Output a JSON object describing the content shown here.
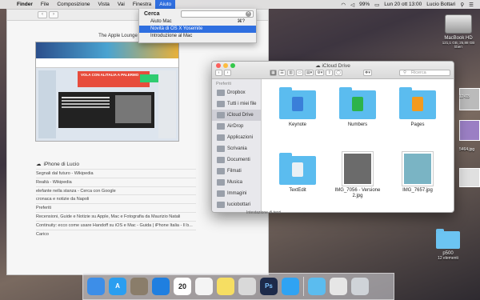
{
  "menubar": {
    "apple_icon": "apple-icon",
    "items": [
      {
        "label": "Finder",
        "bold": true
      },
      {
        "label": "File"
      },
      {
        "label": "Composizione"
      },
      {
        "label": "Vista"
      },
      {
        "label": "Vai"
      },
      {
        "label": "Finestra"
      },
      {
        "label": "Aiuto",
        "active": true
      }
    ],
    "battery": "99%",
    "clock": "Lun 20 ott  13:00",
    "user": "Lucio Bottari"
  },
  "help_menu": {
    "search_label": "Cerca",
    "search_value": "",
    "items": [
      {
        "label": "Aiuto Mac",
        "shortcut": "⌘?"
      },
      {
        "label": "Novità di OS X Yosemite",
        "highlight": true
      },
      {
        "label": "Introduzione al Mac"
      }
    ]
  },
  "safari": {
    "top_site_title": "The Apple Lounge",
    "thumb_banner": "VOLA CON ALITALIA A PALERMO",
    "icloud_tabs_title": "iPhone di Lucio",
    "icloud_tabs": [
      "Segnali dal futuro - Wikipedia",
      "Realtà - Wikipedia",
      "elefante nella stanza - Cerca con Google",
      "cronaca e notizie da Napoli",
      "Preferiti",
      "Recensioni, Guide e Notizie su Apple, Mac e Fotografia da Maurizio Natali",
      "Continuity: ecco come usare Handoff su iOS e Mac - Guida | iPhone Italia - Il b...",
      "Carico"
    ]
  },
  "finder": {
    "title": "iCloud Drive",
    "search_placeholder": "Ricerca",
    "sidebar_header": "Preferiti",
    "sidebar": [
      {
        "label": "Dropbox",
        "icon": "dropbox-icon"
      },
      {
        "label": "Tutti i miei file",
        "icon": "all-files-icon"
      },
      {
        "label": "iCloud Drive",
        "icon": "icloud-icon",
        "active": true
      },
      {
        "label": "AirDrop",
        "icon": "airdrop-icon"
      },
      {
        "label": "Applicazioni",
        "icon": "applications-icon"
      },
      {
        "label": "Scrivania",
        "icon": "desktop-icon"
      },
      {
        "label": "Documenti",
        "icon": "documents-icon"
      },
      {
        "label": "Filmati",
        "icon": "movies-icon"
      },
      {
        "label": "Musica",
        "icon": "music-icon"
      },
      {
        "label": "Immagini",
        "icon": "pictures-icon"
      },
      {
        "label": "luciobottari",
        "icon": "home-icon"
      }
    ],
    "files": [
      {
        "label": "Keynote",
        "kind": "folder",
        "badge_color": "#3a7fd9"
      },
      {
        "label": "Numbers",
        "kind": "folder",
        "badge_color": "#2db34a"
      },
      {
        "label": "Pages",
        "kind": "folder",
        "badge_color": "#f29a1f"
      },
      {
        "label": "TextEdit",
        "kind": "folder",
        "badge_color": "#e9f0f5"
      },
      {
        "label": "IMG_7056 - Versione 2.jpg",
        "kind": "photo",
        "tone": "#6b6b6b"
      },
      {
        "label": "IMG_7657.jpg",
        "kind": "photo",
        "tone": "#7ab4c4"
      }
    ],
    "drag_label": "Intestazione di terzi"
  },
  "desktop": {
    "hd_name": "MacBook HD",
    "hd_sub": "121,1 GB, 25,88 GB liberi",
    "peek_labels": [
      "12-03",
      "5464.jpg"
    ],
    "folder_name": "p500",
    "folder_count": "12 elementi"
  },
  "dock": {
    "apps": [
      {
        "name": "finder-icon",
        "color": "#3d8ee8",
        "glyph": ""
      },
      {
        "name": "app-store-icon",
        "color": "#2a9ef0",
        "glyph": "A"
      },
      {
        "name": "preview-icon",
        "color": "#8a7d6a",
        "glyph": ""
      },
      {
        "name": "safari-icon",
        "color": "#1f7fe0",
        "glyph": ""
      },
      {
        "name": "calendar-icon",
        "color": "#ffffff",
        "glyph": "20"
      },
      {
        "name": "reminders-icon",
        "color": "#f4f4f4",
        "glyph": ""
      },
      {
        "name": "notes-icon",
        "color": "#f6de62",
        "glyph": ""
      },
      {
        "name": "photos-icon",
        "color": "#d9d9d9",
        "glyph": ""
      },
      {
        "name": "photoshop-icon",
        "color": "#1d2a4a",
        "glyph": "Ps"
      },
      {
        "name": "messages-icon",
        "color": "#2fa3f3",
        "glyph": ""
      },
      {
        "sep": true
      },
      {
        "name": "applications-folder-icon",
        "color": "#5bbcef",
        "glyph": ""
      },
      {
        "name": "documents-stack-icon",
        "color": "#e6e6e6",
        "glyph": ""
      },
      {
        "name": "trash-icon",
        "color": "#cfd3d8",
        "glyph": ""
      }
    ]
  }
}
